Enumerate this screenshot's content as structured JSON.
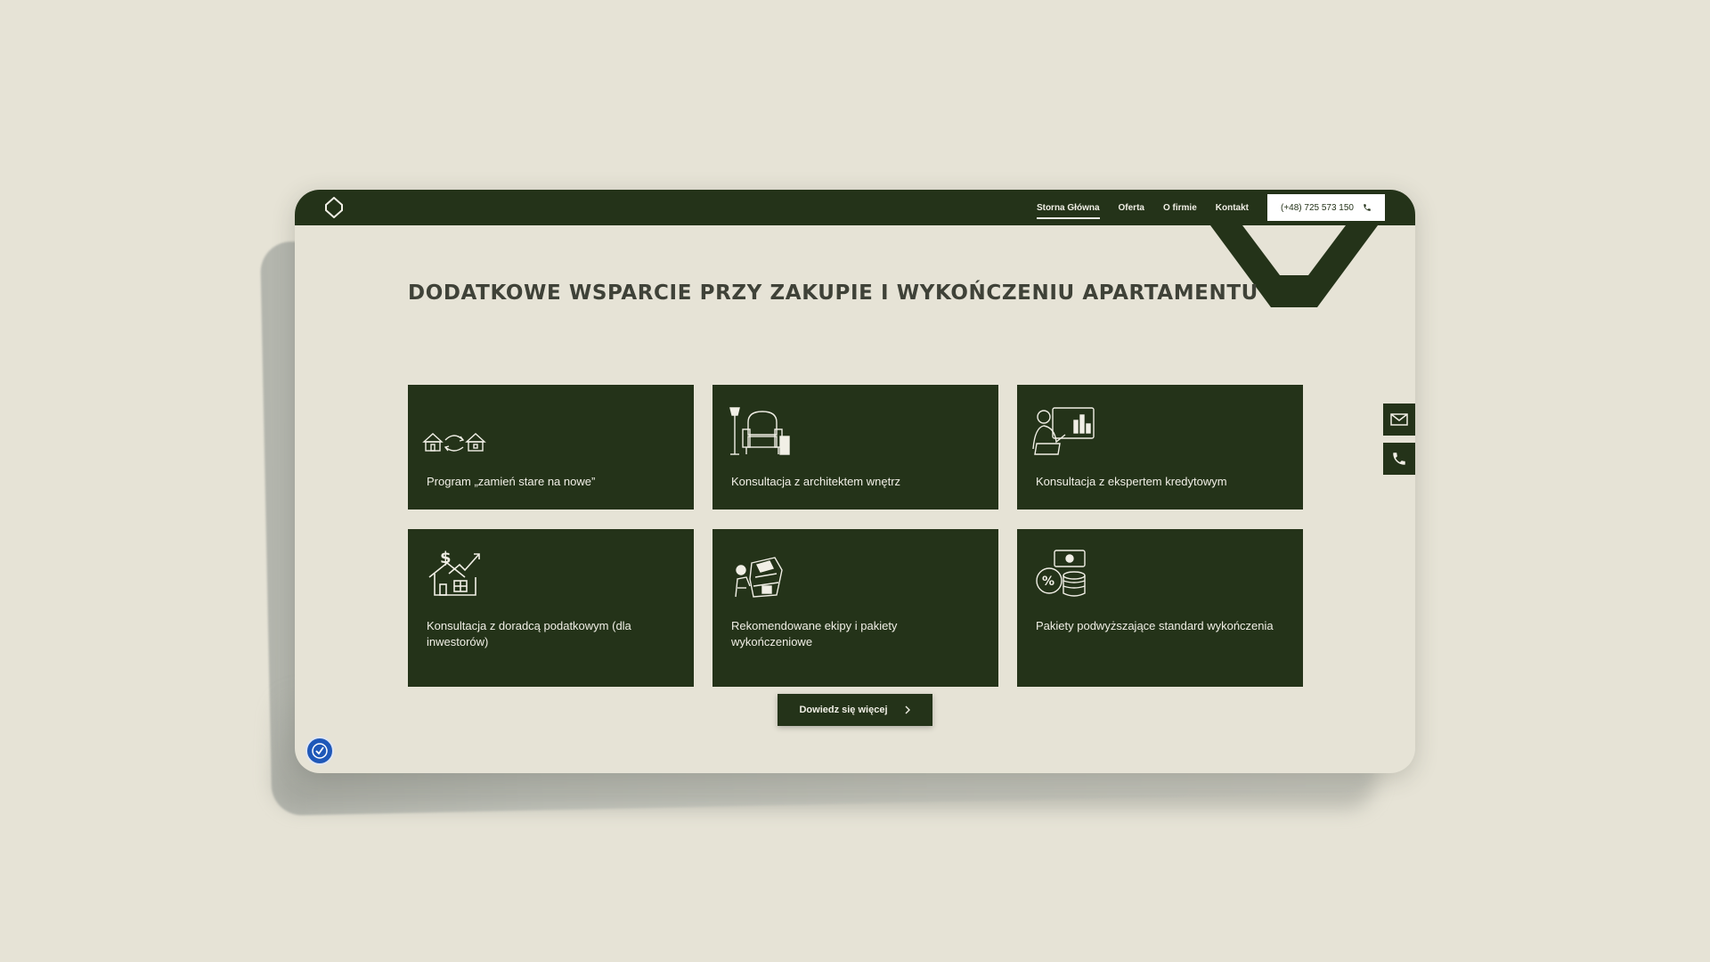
{
  "colors": {
    "brand_green": "#243319",
    "background": "#e6e3d6",
    "heading_text": "#3f4238",
    "card_text": "#f1efe6",
    "accessibility_blue": "#1f58b8"
  },
  "nav": {
    "logo_icon": "diamond-outline-logo-icon",
    "links": [
      "Storna Główna",
      "Oferta",
      "O firmie",
      "Kontakt"
    ],
    "active_link": "Storna Główna",
    "phone_label": "(+48) 725 573 150",
    "phone_icon": "phone-icon"
  },
  "main": {
    "headline": "DODATKOWE WSPARCIE PRZY ZAKUPIE I WYKOŃCZENIU APARTAMENTU",
    "cards": [
      {
        "label": "Program „zamień stare na nowe”",
        "icon": "house-exchange-icon"
      },
      {
        "label": "Konsultacja z architektem wnętrz",
        "icon": "armchair-lamp-icon"
      },
      {
        "label": "Konsultacja z ekspertem kredytowym",
        "icon": "advisor-presentation-icon"
      },
      {
        "label": "Konsultacja z doradcą podatkowym (dla inwestorów)",
        "icon": "house-dollar-growth-icon"
      },
      {
        "label": "Rekomendowane ekipy i pakiety wykończeniowe",
        "icon": "worker-materials-icon"
      },
      {
        "label": "Pakiety podwyższające standard wykończenia",
        "icon": "coins-percent-icon"
      }
    ],
    "more_button": "Dowiedz się więcej"
  },
  "side_contact": {
    "mail_icon": "envelope-icon",
    "phone_icon": "phone-icon"
  },
  "accessibility": {
    "icon": "accessibility-icon"
  }
}
